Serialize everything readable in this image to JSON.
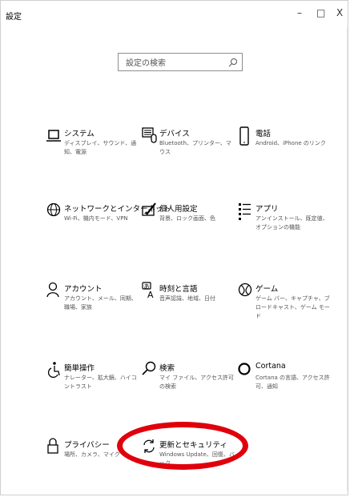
{
  "window": {
    "title": "設定",
    "minimize": "–",
    "maximize": "□",
    "close": "X"
  },
  "search": {
    "placeholder": "設定の検索"
  },
  "colors": {
    "accent": "#0067c0",
    "highlight": "#e0000c"
  },
  "tiles": [
    {
      "title": "システム",
      "desc": "ディスプレイ、サウンド、通知、電源",
      "icon": "laptop-icon"
    },
    {
      "title": "デバイス",
      "desc": "Bluetooth、プリンター、マウス",
      "icon": "keyboard-icon"
    },
    {
      "title": "電話",
      "desc": "Android、iPhone のリンク",
      "icon": "phone-icon"
    },
    {
      "title": "ネットワークとインターネット",
      "desc": "Wi-Fi、機内モード、VPN",
      "icon": "globe-icon"
    },
    {
      "title": "個人用設定",
      "desc": "背景、ロック画面、色",
      "icon": "personalize-icon"
    },
    {
      "title": "アプリ",
      "desc": "アンインストール、既定値、オプションの機能",
      "icon": "apps-list-icon"
    },
    {
      "title": "アカウント",
      "desc": "アカウント、メール、同期、職場、家族",
      "icon": "person-icon"
    },
    {
      "title": "時刻と言語",
      "desc": "音声認識、地域、日付",
      "icon": "time-language-icon"
    },
    {
      "title": "ゲーム",
      "desc": "ゲーム バー、キャプチャ、ブロードキャスト、ゲーム モード",
      "icon": "xbox-icon"
    },
    {
      "title": "簡単操作",
      "desc": "ナレーター、拡大鏡、ハイコントラスト",
      "icon": "ease-of-access-icon"
    },
    {
      "title": "検索",
      "desc": "マイ ファイル、アクセス許可の検索",
      "icon": "search-icon"
    },
    {
      "title": "Cortana",
      "desc": "Cortana の言語、アクセス許可、通知",
      "icon": "cortana-icon"
    },
    {
      "title": "プライバシー",
      "desc": "場所、カメラ、マイク",
      "icon": "lock-icon"
    },
    {
      "title": "更新とセキュリティ",
      "desc": "Windows Update、回復、バック",
      "icon": "update-icon"
    }
  ]
}
